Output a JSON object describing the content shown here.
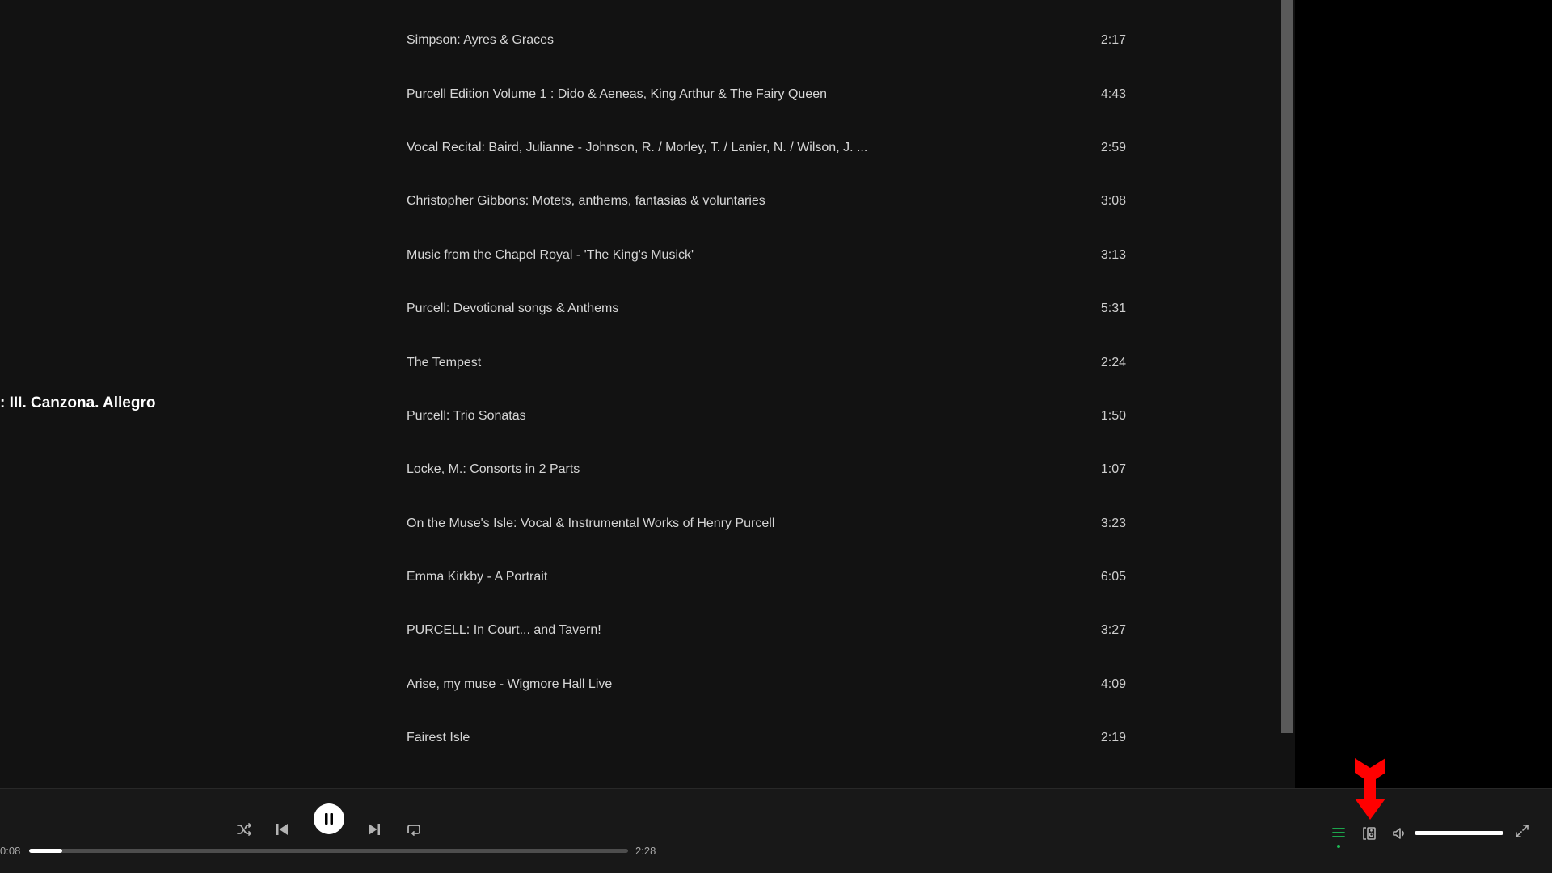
{
  "now_playing": {
    "title_fragment": ": III. Canzona. Allegro"
  },
  "tracks": [
    {
      "title": "Simpson: Ayres & Graces",
      "duration": "2:17"
    },
    {
      "title": "Purcell Edition Volume 1 : Dido & Aeneas, King Arthur & The Fairy Queen",
      "duration": "4:43"
    },
    {
      "title": "Vocal Recital: Baird, Julianne - Johnson, R. / Morley, T. / Lanier, N. / Wilson, J. ...",
      "duration": "2:59"
    },
    {
      "title": "Christopher Gibbons: Motets, anthems, fantasias & voluntaries",
      "duration": "3:08"
    },
    {
      "title": "Music from the Chapel Royal - 'The King's Musick'",
      "duration": "3:13"
    },
    {
      "title": "Purcell: Devotional songs & Anthems",
      "duration": "5:31"
    },
    {
      "title": "The Tempest",
      "duration": "2:24"
    },
    {
      "title": "Purcell: Trio Sonatas",
      "duration": "1:50"
    },
    {
      "title": "Locke, M.: Consorts in 2 Parts",
      "duration": "1:07"
    },
    {
      "title": "On the Muse's Isle: Vocal & Instrumental Works of Henry Purcell",
      "duration": "3:23"
    },
    {
      "title": "Emma Kirkby - A Portrait",
      "duration": "6:05"
    },
    {
      "title": "PURCELL: In Court... and Tavern!",
      "duration": "3:27"
    },
    {
      "title": "Arise, my muse - Wigmore Hall Live",
      "duration": "4:09"
    },
    {
      "title": "Fairest Isle",
      "duration": "2:19"
    }
  ],
  "player": {
    "elapsed": "0:08",
    "total": "2:28",
    "progress_fraction": 0.055,
    "volume_fraction": 1.0,
    "icons": {
      "shuffle": "shuffle-icon",
      "previous": "skip-back-icon",
      "play_pause": "pause-icon",
      "next": "skip-forward-icon",
      "repeat": "repeat-icon",
      "queue": "queue-icon",
      "devices": "connect-device-icon",
      "volume": "volume-icon",
      "fullscreen": "fullscreen-icon"
    }
  },
  "colors": {
    "accent": "#1db954",
    "annotation_arrow": "#ff0000",
    "background": "#121212",
    "player_bar": "#181818"
  }
}
